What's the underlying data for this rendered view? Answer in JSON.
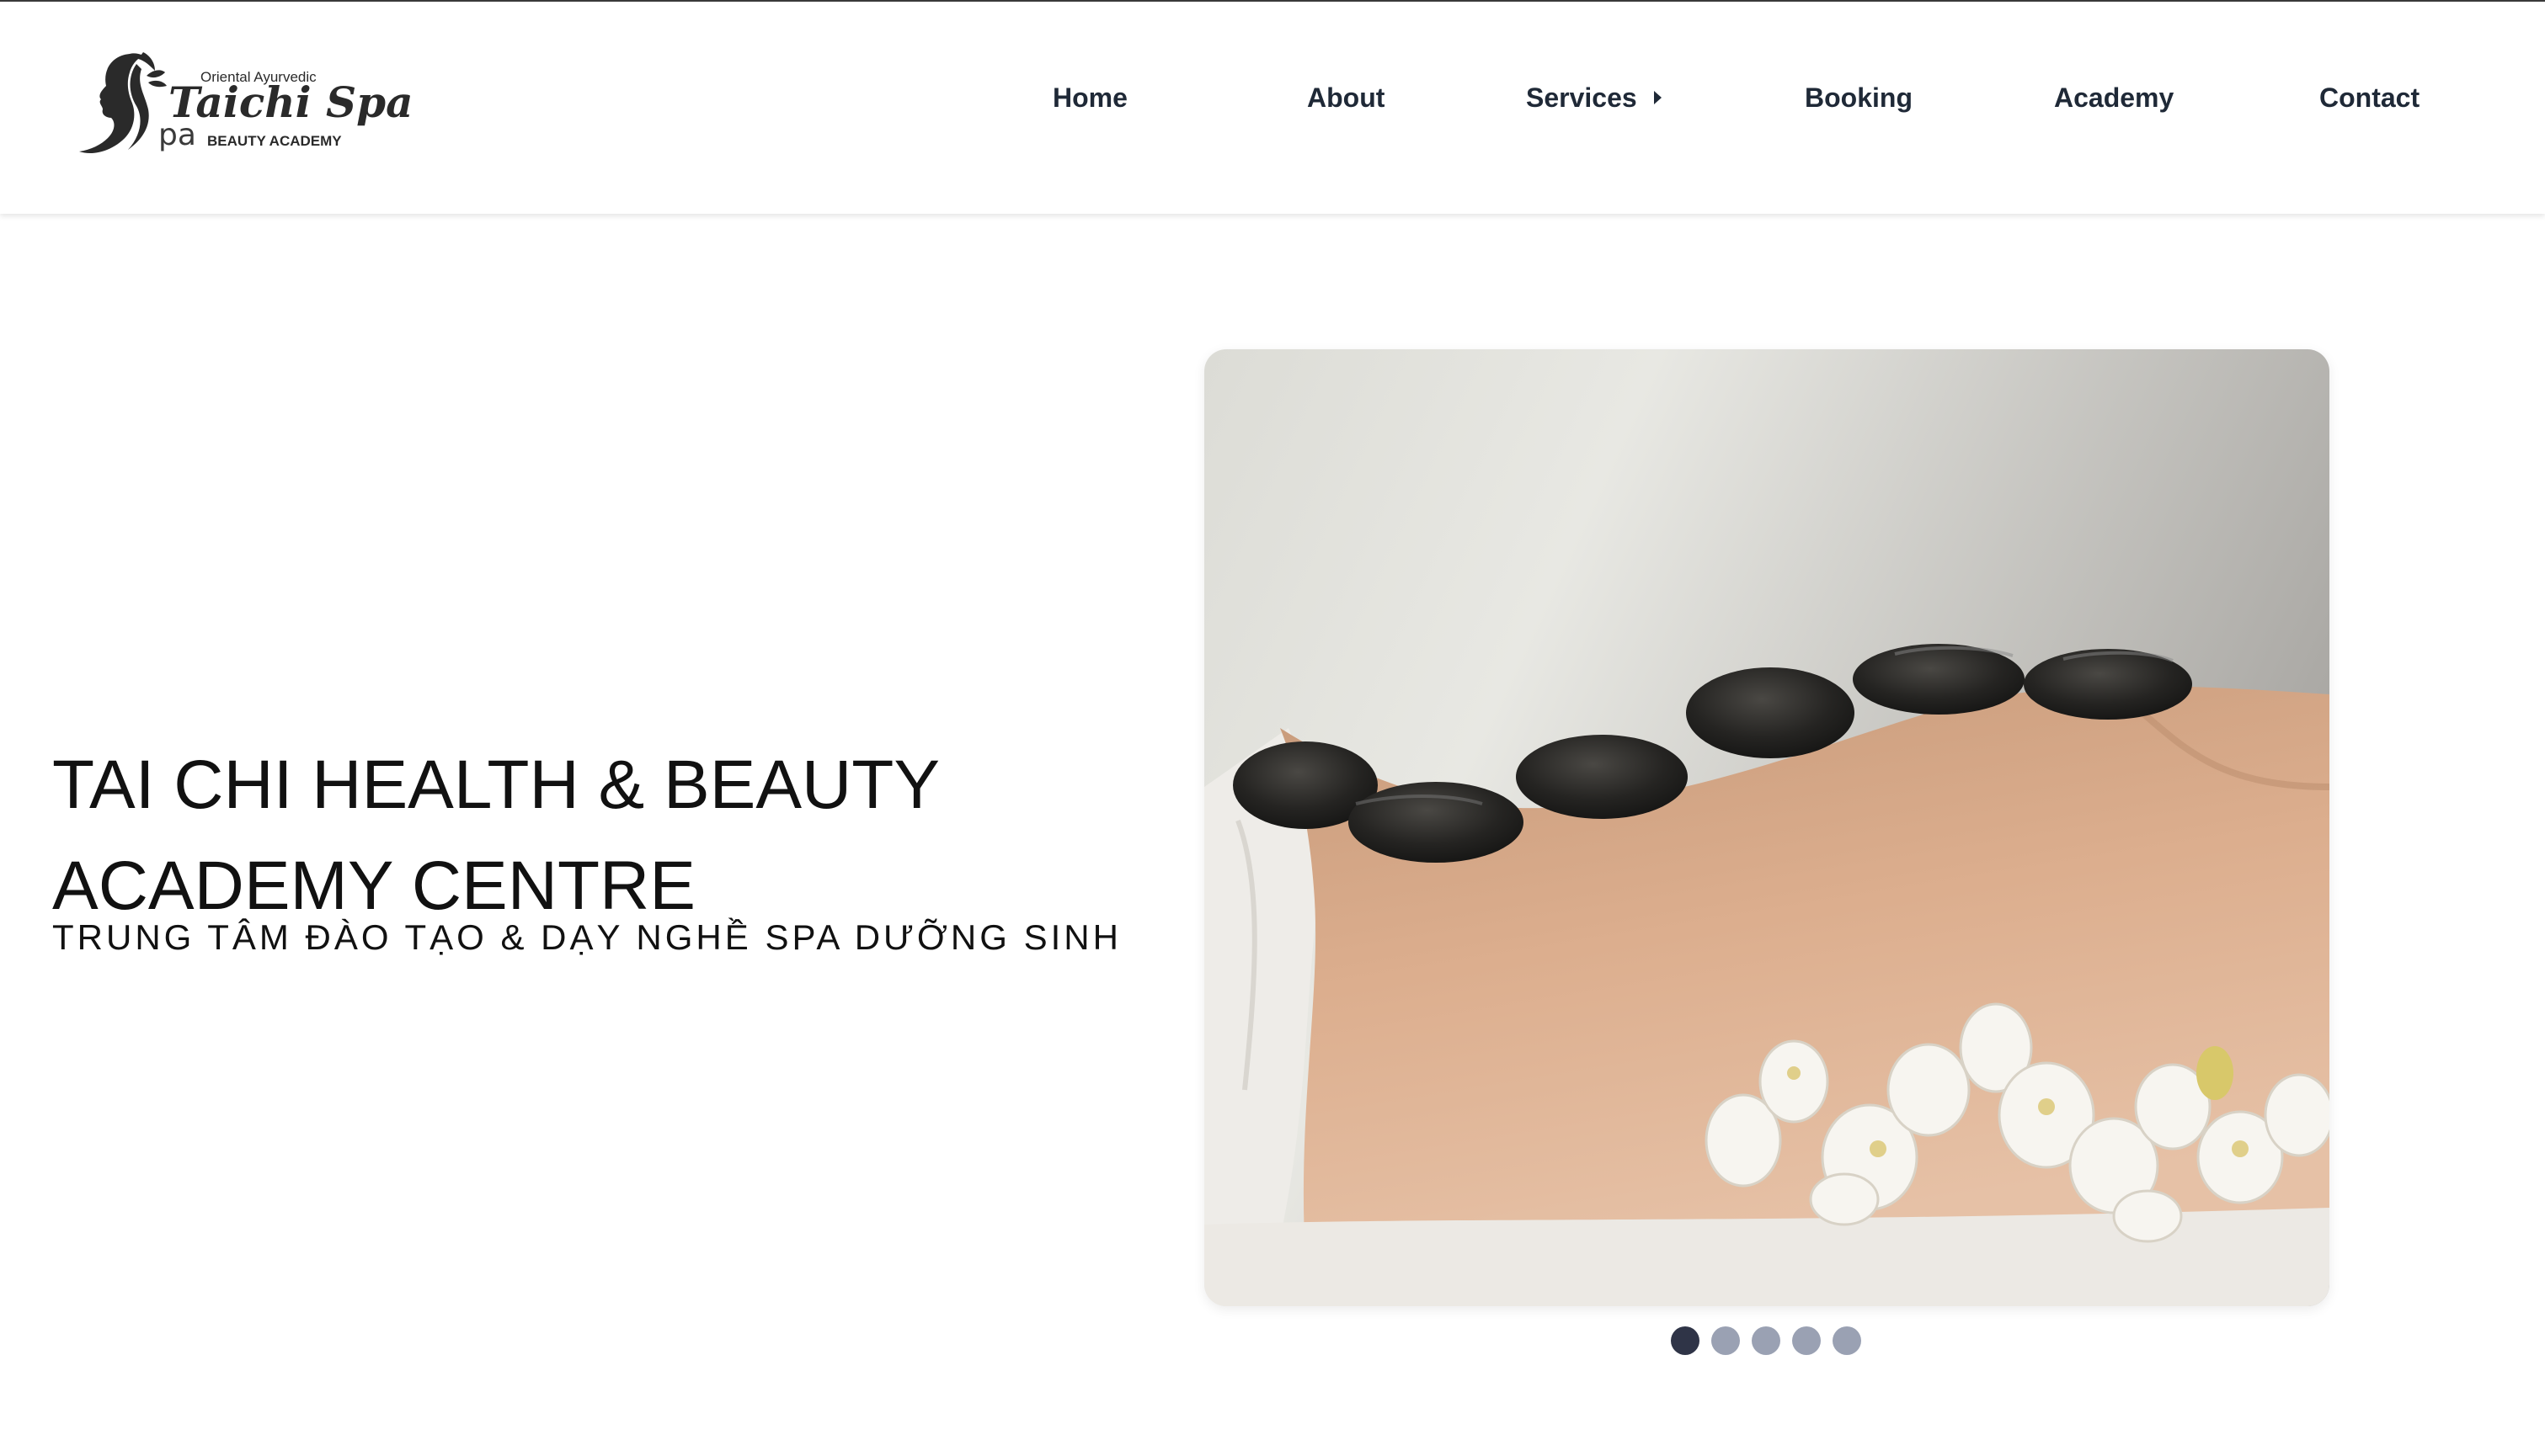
{
  "logo": {
    "tagline": "Oriental Ayurvedic",
    "brand": "Taichi Spa",
    "pa_mark": "pa",
    "subtitle": "BEAUTY ACADEMY"
  },
  "nav": {
    "items": [
      {
        "label": "Home"
      },
      {
        "label": "About"
      },
      {
        "label": "Services"
      },
      {
        "label": "Booking"
      },
      {
        "label": "Academy"
      },
      {
        "label": "Contact"
      }
    ]
  },
  "hero": {
    "title_line1": "TAI CHI HEALTH & BEAUTY",
    "title_line2": "ACADEMY CENTRE",
    "subtitle": "TRUNG TÂM ĐÀO TẠO & DẠY NGHỀ SPA DƯỠNG SINH"
  },
  "carousel": {
    "slide_count": 5,
    "active_index": 0
  },
  "colors": {
    "nav_text": "#1f2937",
    "dot_active": "#2f3447",
    "dot_inactive": "#9aa1b3"
  }
}
